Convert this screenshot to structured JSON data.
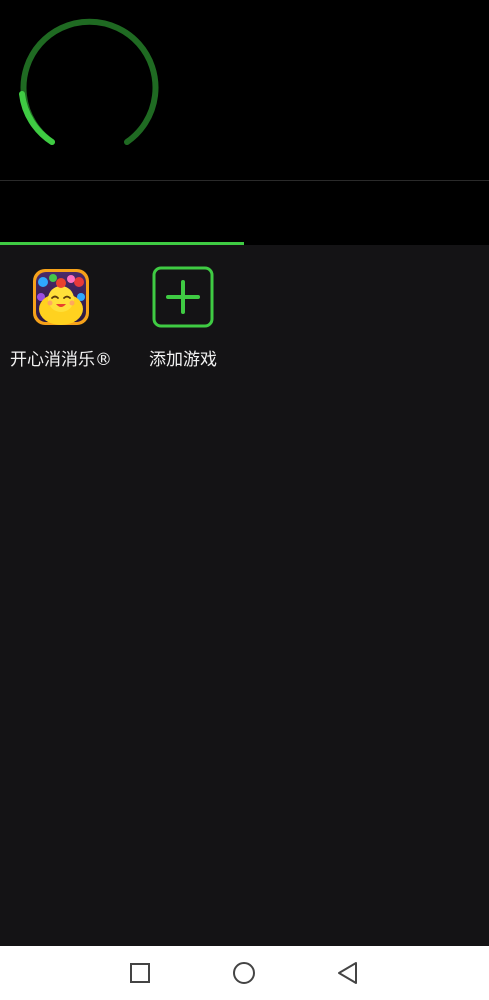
{
  "header": {
    "gauge_icon": "progress-ring-icon"
  },
  "colors": {
    "accent": "#3fcb43",
    "accent_dim": "#1f6a22",
    "content_bg": "#141315",
    "navbar_bg": "#ffffff"
  },
  "games": [
    {
      "label": "开心消消乐®",
      "icon": "game-app-icon"
    },
    {
      "label": "添加游戏",
      "icon": "add-icon"
    }
  ],
  "navbar": {
    "recent_icon": "square-icon",
    "home_icon": "circle-icon",
    "back_icon": "triangle-back-icon"
  }
}
